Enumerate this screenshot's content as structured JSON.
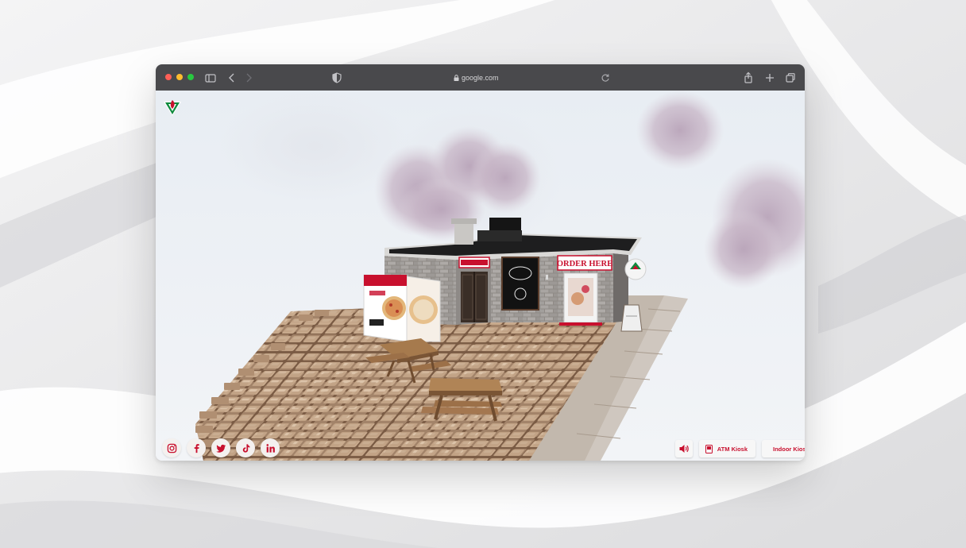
{
  "browser": {
    "address": "google.com",
    "traffic_lights": {
      "close": "#ff5f57",
      "minimize": "#febc2e",
      "maximize": "#28c840"
    },
    "toolbar_color": "#49494c"
  },
  "scene": {
    "sign_order_here": "ORDER HERE",
    "logo_icon": "flame-triangle-logo"
  },
  "social": {
    "items": [
      {
        "name": "instagram",
        "icon": "instagram-icon"
      },
      {
        "name": "facebook",
        "icon": "facebook-icon"
      },
      {
        "name": "twitter",
        "icon": "twitter-icon"
      },
      {
        "name": "tiktok",
        "icon": "tiktok-icon"
      },
      {
        "name": "linkedin",
        "icon": "linkedin-icon"
      }
    ]
  },
  "bottom_bar": {
    "sound_icon": "speaker-icon",
    "atm_kiosk_label": "ATM Kiosk",
    "indoor_kiosk_label": "Indoor Kiosk"
  },
  "colors": {
    "brand_red": "#c8102e",
    "brand_green": "#0e8a3d"
  }
}
